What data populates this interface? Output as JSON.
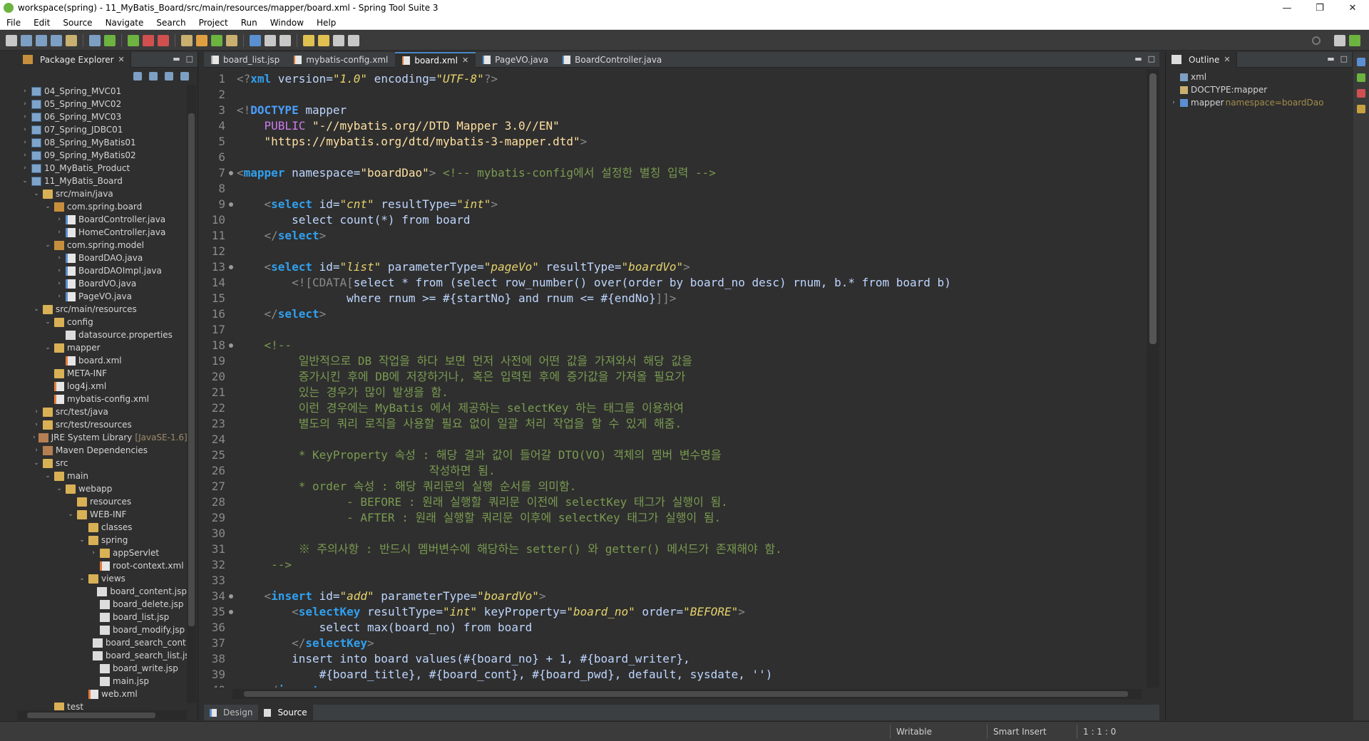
{
  "window": {
    "title": "workspace(spring) - 11_MyBatis_Board/src/main/resources/mapper/board.xml - Spring Tool Suite 3",
    "minimize": "—",
    "maximize": "❐",
    "close": "✕"
  },
  "menu": [
    "File",
    "Edit",
    "Source",
    "Navigate",
    "Search",
    "Project",
    "Run",
    "Window",
    "Help"
  ],
  "explorer": {
    "title": "Package Explorer",
    "items": [
      {
        "label": "04_Spring_MVC01",
        "depth": 0,
        "twisty": ">",
        "icon": "project"
      },
      {
        "label": "05_Spring_MVC02",
        "depth": 0,
        "twisty": ">",
        "icon": "project"
      },
      {
        "label": "06_Spring_MVC03",
        "depth": 0,
        "twisty": ">",
        "icon": "project"
      },
      {
        "label": "07_Spring_JDBC01",
        "depth": 0,
        "twisty": ">",
        "icon": "project"
      },
      {
        "label": "08_Spring_MyBatis01",
        "depth": 0,
        "twisty": ">",
        "icon": "project"
      },
      {
        "label": "09_Spring_MyBatis02",
        "depth": 0,
        "twisty": ">",
        "icon": "project"
      },
      {
        "label": "10_MyBatis_Product",
        "depth": 0,
        "twisty": ">",
        "icon": "project"
      },
      {
        "label": "11_MyBatis_Board",
        "depth": 0,
        "twisty": "v",
        "icon": "project"
      },
      {
        "label": "src/main/java",
        "depth": 1,
        "twisty": "v",
        "icon": "folder"
      },
      {
        "label": "com.spring.board",
        "depth": 2,
        "twisty": "v",
        "icon": "package"
      },
      {
        "label": "BoardController.java",
        "depth": 3,
        "twisty": ">",
        "icon": "java"
      },
      {
        "label": "HomeController.java",
        "depth": 3,
        "twisty": ">",
        "icon": "java"
      },
      {
        "label": "com.spring.model",
        "depth": 2,
        "twisty": "v",
        "icon": "package"
      },
      {
        "label": "BoardDAO.java",
        "depth": 3,
        "twisty": ">",
        "icon": "java"
      },
      {
        "label": "BoardDAOImpl.java",
        "depth": 3,
        "twisty": ">",
        "icon": "java"
      },
      {
        "label": "BoardVO.java",
        "depth": 3,
        "twisty": ">",
        "icon": "java"
      },
      {
        "label": "PageVO.java",
        "depth": 3,
        "twisty": ">",
        "icon": "java"
      },
      {
        "label": "src/main/resources",
        "depth": 1,
        "twisty": "v",
        "icon": "folder"
      },
      {
        "label": "config",
        "depth": 2,
        "twisty": "v",
        "icon": "folder"
      },
      {
        "label": "datasource.properties",
        "depth": 3,
        "twisty": "",
        "icon": "file"
      },
      {
        "label": "mapper",
        "depth": 2,
        "twisty": "v",
        "icon": "folder"
      },
      {
        "label": "board.xml",
        "depth": 3,
        "twisty": "",
        "icon": "xml"
      },
      {
        "label": "META-INF",
        "depth": 2,
        "twisty": "",
        "icon": "folder"
      },
      {
        "label": "log4j.xml",
        "depth": 2,
        "twisty": "",
        "icon": "xml"
      },
      {
        "label": "mybatis-config.xml",
        "depth": 2,
        "twisty": "",
        "icon": "xml"
      },
      {
        "label": "src/test/java",
        "depth": 1,
        "twisty": ">",
        "icon": "folder"
      },
      {
        "label": "src/test/resources",
        "depth": 1,
        "twisty": ">",
        "icon": "folder"
      },
      {
        "label": "JRE System Library",
        "depth": 1,
        "twisty": ">",
        "icon": "lib",
        "suffix": "[JavaSE-1.6]"
      },
      {
        "label": "Maven Dependencies",
        "depth": 1,
        "twisty": ">",
        "icon": "lib"
      },
      {
        "label": "src",
        "depth": 1,
        "twisty": "v",
        "icon": "folder"
      },
      {
        "label": "main",
        "depth": 2,
        "twisty": "v",
        "icon": "folder"
      },
      {
        "label": "webapp",
        "depth": 3,
        "twisty": "v",
        "icon": "folder"
      },
      {
        "label": "resources",
        "depth": 4,
        "twisty": "",
        "icon": "folder"
      },
      {
        "label": "WEB-INF",
        "depth": 4,
        "twisty": "v",
        "icon": "folder"
      },
      {
        "label": "classes",
        "depth": 5,
        "twisty": "",
        "icon": "folder"
      },
      {
        "label": "spring",
        "depth": 5,
        "twisty": "v",
        "icon": "folder"
      },
      {
        "label": "appServlet",
        "depth": 6,
        "twisty": ">",
        "icon": "folder"
      },
      {
        "label": "root-context.xml",
        "depth": 6,
        "twisty": "",
        "icon": "xml"
      },
      {
        "label": "views",
        "depth": 5,
        "twisty": "v",
        "icon": "folder"
      },
      {
        "label": "board_content.jsp",
        "depth": 6,
        "twisty": "",
        "icon": "file"
      },
      {
        "label": "board_delete.jsp",
        "depth": 6,
        "twisty": "",
        "icon": "file"
      },
      {
        "label": "board_list.jsp",
        "depth": 6,
        "twisty": "",
        "icon": "file"
      },
      {
        "label": "board_modify.jsp",
        "depth": 6,
        "twisty": "",
        "icon": "file"
      },
      {
        "label": "board_search_cont.",
        "depth": 6,
        "twisty": "",
        "icon": "file"
      },
      {
        "label": "board_search_list.js",
        "depth": 6,
        "twisty": "",
        "icon": "file"
      },
      {
        "label": "board_write.jsp",
        "depth": 6,
        "twisty": "",
        "icon": "file"
      },
      {
        "label": "main.jsp",
        "depth": 6,
        "twisty": "",
        "icon": "file"
      },
      {
        "label": "web.xml",
        "depth": 5,
        "twisty": "",
        "icon": "xml"
      },
      {
        "label": "test",
        "depth": 2,
        "twisty": "",
        "icon": "folder"
      }
    ]
  },
  "editor": {
    "tabs": [
      {
        "label": "board_list.jsp",
        "active": false,
        "kind": "file"
      },
      {
        "label": "mybatis-config.xml",
        "active": false,
        "kind": "xml"
      },
      {
        "label": "board.xml",
        "active": true,
        "kind": "xml"
      },
      {
        "label": "PageVO.java",
        "active": false,
        "kind": "java"
      },
      {
        "label": "BoardController.java",
        "active": false,
        "kind": "java"
      }
    ],
    "fold_lines": [
      7,
      9,
      13,
      18,
      34,
      35
    ],
    "lines": [
      [
        [
          "br",
          "<?"
        ],
        [
          "tag2",
          "xml"
        ],
        [
          "attr",
          " version="
        ],
        [
          "val",
          "\"1.0\""
        ],
        [
          "attr",
          " encoding="
        ],
        [
          "val",
          "\"UTF-8\""
        ],
        [
          "br",
          "?>"
        ]
      ],
      [],
      [
        [
          "br",
          "<!"
        ],
        [
          "doc",
          "DOCTYPE"
        ],
        [
          "attr",
          " mapper"
        ]
      ],
      [
        [
          "pub",
          "    PUBLIC "
        ],
        [
          "str",
          "\"-//mybatis.org//DTD Mapper 3.0//EN\""
        ]
      ],
      [
        [
          "str",
          "    \"https://mybatis.org/dtd/mybatis-3-mapper.dtd\""
        ],
        [
          "br",
          ">"
        ]
      ],
      [],
      [
        [
          "br",
          "<"
        ],
        [
          "tag2",
          "mapper"
        ],
        [
          "attr",
          " namespace="
        ],
        [
          "str",
          "\"boardDao\""
        ],
        [
          "br",
          "> "
        ],
        [
          "cmt",
          "<!-- mybatis-config에서 설정한 별칭 입력 -->"
        ]
      ],
      [],
      [
        [
          "attr",
          "    "
        ],
        [
          "br",
          "<"
        ],
        [
          "tag2",
          "select"
        ],
        [
          "attr",
          " id="
        ],
        [
          "val",
          "\"cnt\""
        ],
        [
          "attr",
          " resultType="
        ],
        [
          "val",
          "\"int\""
        ],
        [
          "br",
          ">"
        ]
      ],
      [
        [
          "attr",
          "        select count(*) from board"
        ]
      ],
      [
        [
          "attr",
          "    "
        ],
        [
          "br",
          "</"
        ],
        [
          "tag2",
          "select"
        ],
        [
          "br",
          ">"
        ]
      ],
      [],
      [
        [
          "attr",
          "    "
        ],
        [
          "br",
          "<"
        ],
        [
          "tag2",
          "select"
        ],
        [
          "attr",
          " id="
        ],
        [
          "val",
          "\"list\""
        ],
        [
          "attr",
          " parameterType="
        ],
        [
          "val",
          "\"pageVo\""
        ],
        [
          "attr",
          " resultType="
        ],
        [
          "val",
          "\"boardVo\""
        ],
        [
          "br",
          ">"
        ]
      ],
      [
        [
          "attr",
          "        "
        ],
        [
          "br",
          "<![CDATA["
        ],
        [
          "attr",
          "select * from (select row_number() over(order by board_no desc) rnum, b.* from board b)"
        ]
      ],
      [
        [
          "attr",
          "                where rnum >= #{startNo} and rnum <= #{endNo}"
        ],
        [
          "br",
          "]]>"
        ]
      ],
      [
        [
          "attr",
          "    "
        ],
        [
          "br",
          "</"
        ],
        [
          "tag2",
          "select"
        ],
        [
          "br",
          ">"
        ]
      ],
      [],
      [
        [
          "cmt",
          "    <!--"
        ]
      ],
      [
        [
          "cmt",
          "         일반적으로 DB 작업을 하다 보면 먼저 사전에 어떤 값을 가져와서 해당 값을"
        ]
      ],
      [
        [
          "cmt",
          "         증가시킨 후에 DB에 저장하거나, 혹은 입력된 후에 증가값을 가져올 필요가"
        ]
      ],
      [
        [
          "cmt",
          "         있는 경우가 많이 발생을 함."
        ]
      ],
      [
        [
          "cmt",
          "         이런 경우에는 MyBatis 에서 제공하는 selectKey 하는 태그를 이용하여"
        ]
      ],
      [
        [
          "cmt",
          "         별도의 쿼리 로직을 사용할 필요 없이 일괄 처리 작업을 할 수 있게 해줌."
        ]
      ],
      [],
      [
        [
          "cmt",
          "         * KeyProperty 속성 : 해당 결과 값이 들어갈 DTO(VO) 객체의 멤버 변수명을"
        ]
      ],
      [
        [
          "cmt",
          "                            작성하면 됨."
        ]
      ],
      [
        [
          "cmt",
          "         * order 속성 : 해당 쿼리문의 실행 순서를 의미함."
        ]
      ],
      [
        [
          "cmt",
          "                - BEFORE : 원래 실행할 쿼리문 이전에 selectKey 태그가 실행이 됨."
        ]
      ],
      [
        [
          "cmt",
          "                - AFTER : 원래 실행할 쿼리문 이후에 selectKey 태그가 실행이 됨."
        ]
      ],
      [],
      [
        [
          "cmt",
          "         ※ 주의사항 : 반드시 멤버변수에 해당하는 setter() 와 getter() 메서드가 존재해야 함."
        ]
      ],
      [
        [
          "cmt",
          "     -->"
        ]
      ],
      [],
      [
        [
          "attr",
          "    "
        ],
        [
          "br",
          "<"
        ],
        [
          "tag2",
          "insert"
        ],
        [
          "attr",
          " id="
        ],
        [
          "val",
          "\"add\""
        ],
        [
          "attr",
          " parameterType="
        ],
        [
          "val",
          "\"boardVo\""
        ],
        [
          "br",
          ">"
        ]
      ],
      [
        [
          "attr",
          "        "
        ],
        [
          "br",
          "<"
        ],
        [
          "tag2",
          "selectKey"
        ],
        [
          "attr",
          " resultType="
        ],
        [
          "val",
          "\"int\""
        ],
        [
          "attr",
          " keyProperty="
        ],
        [
          "val",
          "\"board_no\""
        ],
        [
          "attr",
          " order="
        ],
        [
          "val",
          "\"BEFORE\""
        ],
        [
          "br",
          ">"
        ]
      ],
      [
        [
          "attr",
          "            select max(board_no) from board"
        ]
      ],
      [
        [
          "attr",
          "        "
        ],
        [
          "br",
          "</"
        ],
        [
          "tag2",
          "selectKey"
        ],
        [
          "br",
          ">"
        ]
      ],
      [
        [
          "attr",
          "        insert into board values(#{board_no} + 1, #{board_writer},"
        ]
      ],
      [
        [
          "attr",
          "            #{board_title}, #{board_cont}, #{board_pwd}, default, sysdate, '')"
        ]
      ],
      [
        [
          "attr",
          "    "
        ],
        [
          "br",
          "</"
        ],
        [
          "tag2",
          "insert"
        ],
        [
          "br",
          ">"
        ]
      ]
    ],
    "bottom_tabs": [
      "Design",
      "Source"
    ]
  },
  "outline": {
    "title": "Outline",
    "items": [
      {
        "label": "xml",
        "twisty": "",
        "icon": "pi"
      },
      {
        "label": "DOCTYPE:mapper",
        "twisty": "",
        "icon": "doctype"
      },
      {
        "label": "mapper",
        "twisty": ">",
        "icon": "element",
        "suffix": "namespace=boardDao"
      }
    ]
  },
  "status": {
    "writable": "Writable",
    "insert_mode": "Smart Insert",
    "position": "1 : 1 : 0"
  }
}
